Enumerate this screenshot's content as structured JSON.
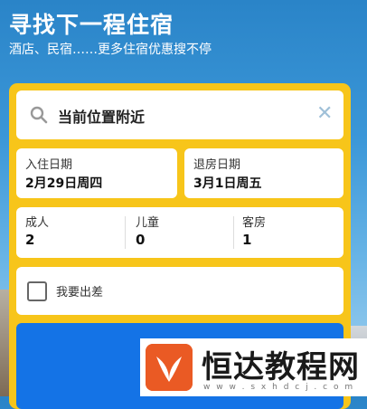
{
  "header": {
    "title": "寻找下一程住宿",
    "subtitle": "酒店、民宿……更多住宿优惠搜不停"
  },
  "search": {
    "location_text": "当前位置附近",
    "search_icon": "search-icon",
    "clear_icon": "close-icon"
  },
  "dates": {
    "checkin_label": "入住日期",
    "checkin_value": "2月29日周四",
    "checkout_label": "退房日期",
    "checkout_value": "3月1日周五"
  },
  "guests": {
    "adults_label": "成人",
    "adults_value": "2",
    "children_label": "儿童",
    "children_value": "0",
    "rooms_label": "客房",
    "rooms_value": "1"
  },
  "trip": {
    "business_label": "我要出差",
    "checked": false
  },
  "watermark": {
    "title": "恒达教程网",
    "url": "w w w . s x h d c j . c o m"
  },
  "colors": {
    "panel": "#f7c51a",
    "button": "#1473e6",
    "sky": "#3b97d8"
  }
}
